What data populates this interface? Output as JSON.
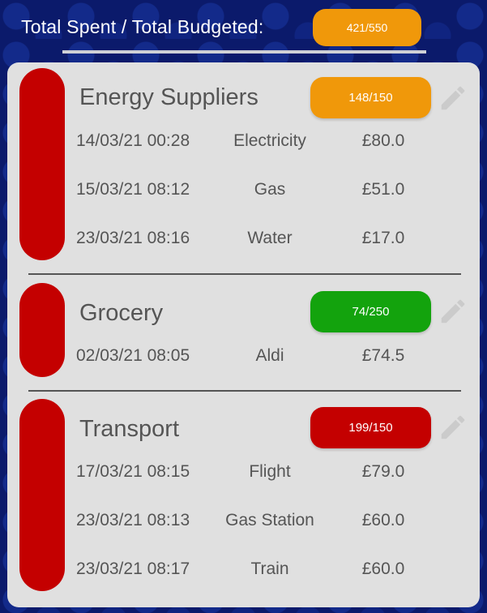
{
  "header": {
    "label": "Total Spent / Total Budgeted:",
    "total": "421/550",
    "total_color": "#f0980a"
  },
  "categories": [
    {
      "title": "Energy Suppliers",
      "budget": "148/150",
      "budget_color": "#f0980a",
      "edit_icon": "pencil-icon",
      "transactions": [
        {
          "date": "14/03/21 00:28",
          "name": "Electricity",
          "amount": "£80.0"
        },
        {
          "date": "15/03/21 08:12",
          "name": "Gas",
          "amount": "£51.0"
        },
        {
          "date": "23/03/21 08:16",
          "name": "Water",
          "amount": "£17.0"
        }
      ]
    },
    {
      "title": "Grocery",
      "budget": "74/250",
      "budget_color": "#13a30d",
      "edit_icon": "pencil-icon",
      "transactions": [
        {
          "date": "02/03/21 08:05",
          "name": "Aldi",
          "amount": "£74.5"
        }
      ]
    },
    {
      "title": "Transport",
      "budget": "199/150",
      "budget_color": "#c40000",
      "edit_icon": "pencil-icon",
      "transactions": [
        {
          "date": "17/03/21 08:15",
          "name": "Flight",
          "amount": "£79.0"
        },
        {
          "date": "23/03/21 08:13",
          "name": "Gas Station",
          "amount": "£60.0"
        },
        {
          "date": "23/03/21 08:17",
          "name": "Train",
          "amount": "£60.0"
        }
      ]
    }
  ],
  "colors": {
    "category_bar": "#c40000",
    "panel": "#e0e0e0",
    "text": "#555555",
    "background": "#0b1a6b"
  }
}
